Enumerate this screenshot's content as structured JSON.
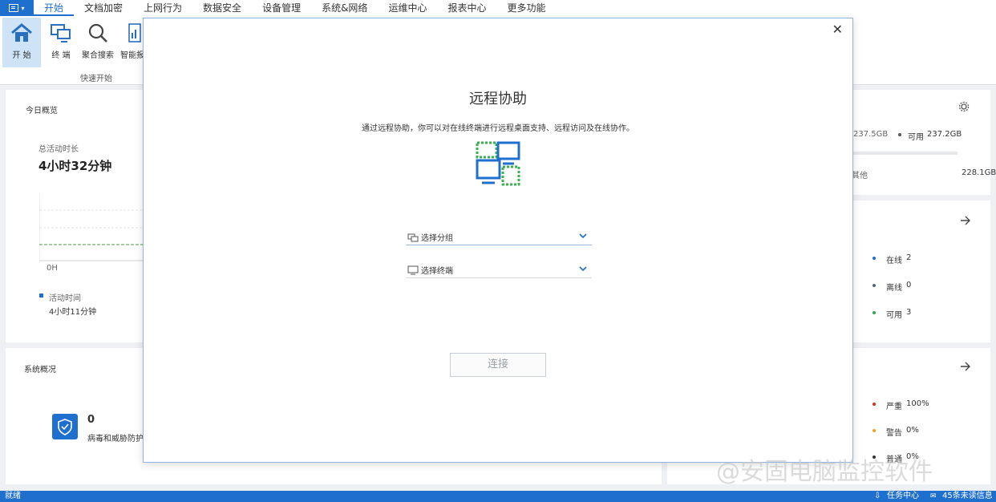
{
  "menubar": {
    "items": [
      "开始",
      "文档加密",
      "上网行为",
      "数据安全",
      "设备管理",
      "系统&网络",
      "运维中心",
      "报表中心",
      "更多功能"
    ],
    "active_index": 0
  },
  "ribbon": {
    "buttons": [
      {
        "label": "开 始",
        "icon": "home-icon"
      },
      {
        "label": "终 端",
        "icon": "terminal-icon"
      },
      {
        "label": "聚合搜索",
        "icon": "search-icon"
      },
      {
        "label": "智能报",
        "icon": "report-icon"
      }
    ],
    "group_label": "快速开始"
  },
  "overview": {
    "title": "今日概览",
    "total_label": "总活动时长",
    "total_value": "4小时32分钟",
    "axis_label": "0H",
    "legend_label": "活动时间",
    "legend_value": "4小时11分钟"
  },
  "disk": {
    "used_text": "237.5GB",
    "avail_label": "可用",
    "avail_value": "237.2GB",
    "other_label": "其他",
    "other_value": "228.1GB"
  },
  "terminals": {
    "items": [
      {
        "label": "在线",
        "value": "2",
        "color": "#1f6fcf"
      },
      {
        "label": "离线",
        "value": "0",
        "color": "#5a6470"
      },
      {
        "label": "可用",
        "value": "3",
        "color": "#2fa84f"
      }
    ]
  },
  "alerts": {
    "items": [
      {
        "label": "严重",
        "value": "100%",
        "color": "#d9301f"
      },
      {
        "label": "警告",
        "value": "0%",
        "color": "#f3a31a"
      },
      {
        "label": "普通",
        "value": "0%",
        "color": "#333333"
      }
    ]
  },
  "system": {
    "title": "系统概况",
    "virus_count": "0",
    "virus_label": "病毒和威胁防护"
  },
  "modal": {
    "title": "远程协助",
    "description": "通过远程协助，你可以对在线终端进行远程桌面支持、远程访问及在线协作。",
    "group_placeholder": "选择分组",
    "terminal_placeholder": "选择终端",
    "connect_label": "连接"
  },
  "statusbar": {
    "left": "就绪",
    "task_center": "任务中心",
    "unread": "45条未读信息"
  },
  "watermark": "@安固电脑监控软件",
  "colors": {
    "accent": "#1f6fcf",
    "hero_green": "#38b24a"
  }
}
